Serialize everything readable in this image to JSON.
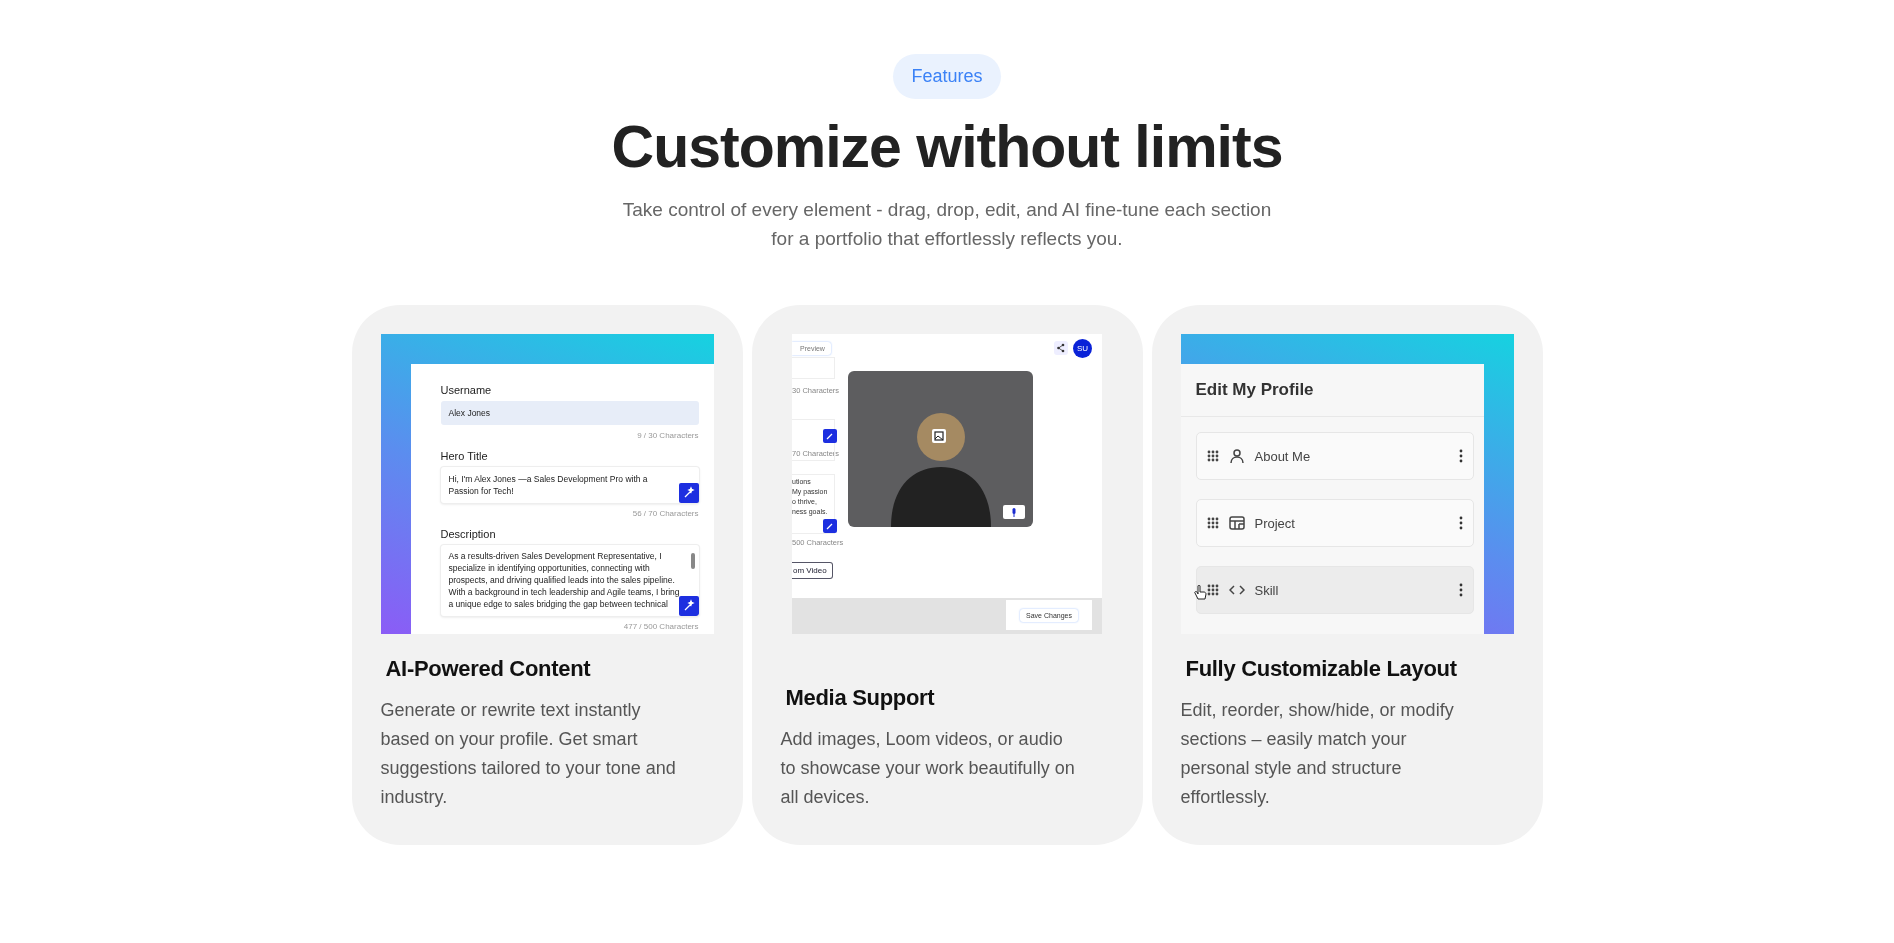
{
  "badge": "Features",
  "title": "Customize without limits",
  "subtitle": "Take control of every element - drag, drop, edit, and AI fine-tune each section for a portfolio that effortlessly reflects you.",
  "cards": [
    {
      "kind": "form",
      "title": "AI-Powered Content",
      "description": "Generate or rewrite text instantly based on your profile. Get smart suggestions tailored to your tone and industry.",
      "preview": {
        "fields": [
          {
            "label": "Username",
            "value": "Alex Jones",
            "counter": "9 / 30 Characters",
            "focused": true,
            "ai_button": false,
            "scrollable": false
          },
          {
            "label": "Hero Title",
            "value": "Hi, I'm Alex Jones —a Sales Development Pro with a Passion for Tech!",
            "counter": "56 / 70 Characters",
            "focused": false,
            "ai_button": true,
            "scrollable": false
          },
          {
            "label": "Description",
            "value": "As a results-driven Sales Development Representative, I specialize in identifying opportunities, connecting with prospects, and driving qualified leads into the sales pipeline. With a background in tech leadership and Agile teams, I bring a unique edge to sales bridging the gap between technical",
            "counter": "477 / 500 Characters",
            "focused": false,
            "ai_button": true,
            "scrollable": true
          }
        ]
      }
    },
    {
      "kind": "media",
      "title": "Media Support",
      "description": "Add images, Loom videos, or audio to showcase your work beautifully on all devices.",
      "preview": {
        "preview_button": "Preview",
        "avatar": "SU",
        "counters": [
          "30 Characters",
          "70 Characters",
          "500 Characters"
        ],
        "excerpt": [
          "utions",
          "My passion",
          "o thrive,",
          "ness goals."
        ],
        "video_button": "om Video",
        "save_button": "Save Changes"
      }
    },
    {
      "kind": "layout",
      "title": "Fully Customizable Layout",
      "description": "Edit, reorder, show/hide, or modify sections – easily match your personal style and structure effortlessly.",
      "preview": {
        "heading": "Edit My Profile",
        "sections": [
          {
            "label": "About Me",
            "hovered": false
          },
          {
            "label": "Project",
            "hovered": false
          },
          {
            "label": "Skill",
            "hovered": true
          }
        ]
      }
    }
  ]
}
